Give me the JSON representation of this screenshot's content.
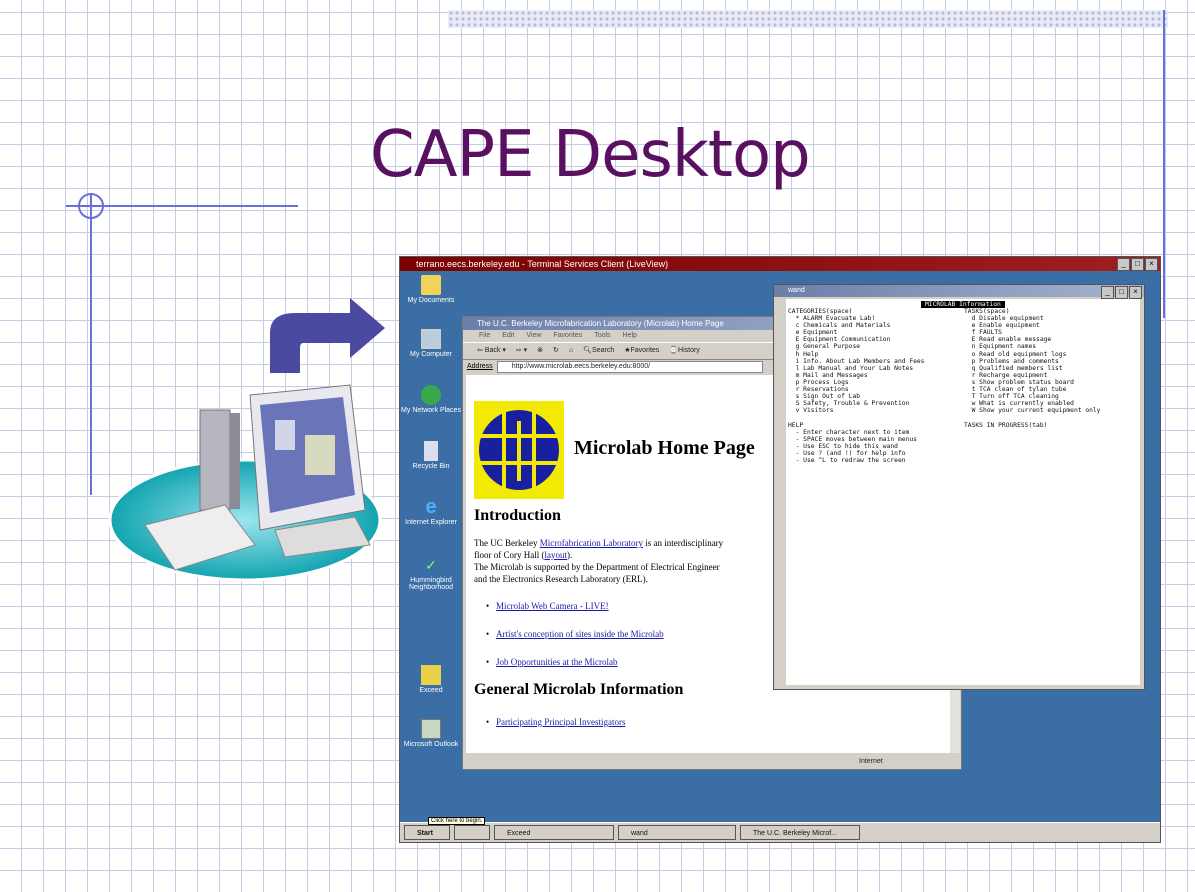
{
  "slide": {
    "title": "CAPE Desktop"
  },
  "remote_window": {
    "title": "terrano.eecs.berkeley.edu - Terminal Services Client (LiveView)"
  },
  "desktop_icons": [
    {
      "label": "My Documents"
    },
    {
      "label": "My Computer"
    },
    {
      "label": "My Network Places"
    },
    {
      "label": "Recycle Bin"
    },
    {
      "label": "Internet Explorer"
    },
    {
      "label": "Hummingbird Neighborhood"
    },
    {
      "label": "Exceed"
    },
    {
      "label": "Microsoft Outlook"
    }
  ],
  "browser": {
    "title": "The U.C. Berkeley Microfabrication Laboratory (Microlab) Home Page",
    "menu": [
      "File",
      "Edit",
      "View",
      "Favorites",
      "Tools",
      "Help"
    ],
    "toolbar": {
      "back": "Back",
      "search": "Search",
      "favorites": "Favorites",
      "history": "History"
    },
    "address_label": "Address",
    "address_value": "http://www.microlab.eecs.berkeley.edu:8000/",
    "page": {
      "heading": "Microlab Home Page",
      "intro_heading": "Introduction",
      "intro_1a": "The UC Berkeley ",
      "intro_1_link": "Microfabrication Laboratory",
      "intro_1b": " is an interdisciplinary",
      "intro_2a": "floor of Cory Hall (",
      "intro_2_link": "layout",
      "intro_2b": ").",
      "intro_3": "The Microlab is supported by the Department of Electrical Engineer",
      "intro_4": "and the Electronics Research Laboratory (ERL).",
      "links": [
        "Microlab Web Camera - LIVE!",
        "Artist's conception of sites inside the Microlab",
        "Job Opportunities at the Microlab"
      ],
      "general_heading": "General Microlab Information",
      "general_links": [
        "Participating Principal Investigators"
      ]
    },
    "status_zone": "Internet"
  },
  "terminal": {
    "title": "wand",
    "banner": "MICROLAB Information",
    "left_lines": [
      "CATEGORIES(space)",
      "  * ALARM Evacuate Lab!",
      "  c Chemicals and Materials",
      "  e Equipment",
      "  E Equipment Communication",
      "  g General Purpose",
      "  h Help",
      "  i Info. About Lab Members and Fees",
      "  l Lab Manual and Your Lab Notes",
      "  m Mail and Messages",
      "  p Process Logs",
      "  r Reservations",
      "  s Sign Out of Lab",
      "  S Safety, Trouble & Prevention",
      "  v Visitors",
      "",
      "HELP",
      "  - Enter character next to item",
      "  - SPACE moves between main menus",
      "  - Use ESC to hide this wand",
      "  - Use ? (and !) for help info",
      "  - Use ^L to redraw the screen"
    ],
    "right_lines": [
      "TASKS(space)",
      "  d Disable equipment",
      "  e Enable equipment",
      "  f FAULTS",
      "  E Read enable message",
      "  n Equipment names",
      "  o Read old equipment logs",
      "  p Problems and comments",
      "  q Qualified members list",
      "  r Recharge equipment",
      "  s Show problem status board",
      "  t TCA clean of tylan tube",
      "  T Turn off TCA cleaning",
      "  w What is currently enabled",
      "  W Show your current equipment only",
      "",
      "TASKS IN PROGRESS(tab)"
    ]
  },
  "taskbar": {
    "start": "Start",
    "tooltip": "Click here to begin.",
    "items": [
      "Exceed",
      "wand",
      "The U.C. Berkeley Microf..."
    ]
  },
  "colors": {
    "title": "#5a1060",
    "desktop": "#3a6ea5",
    "accent_line": "#6670d8"
  }
}
